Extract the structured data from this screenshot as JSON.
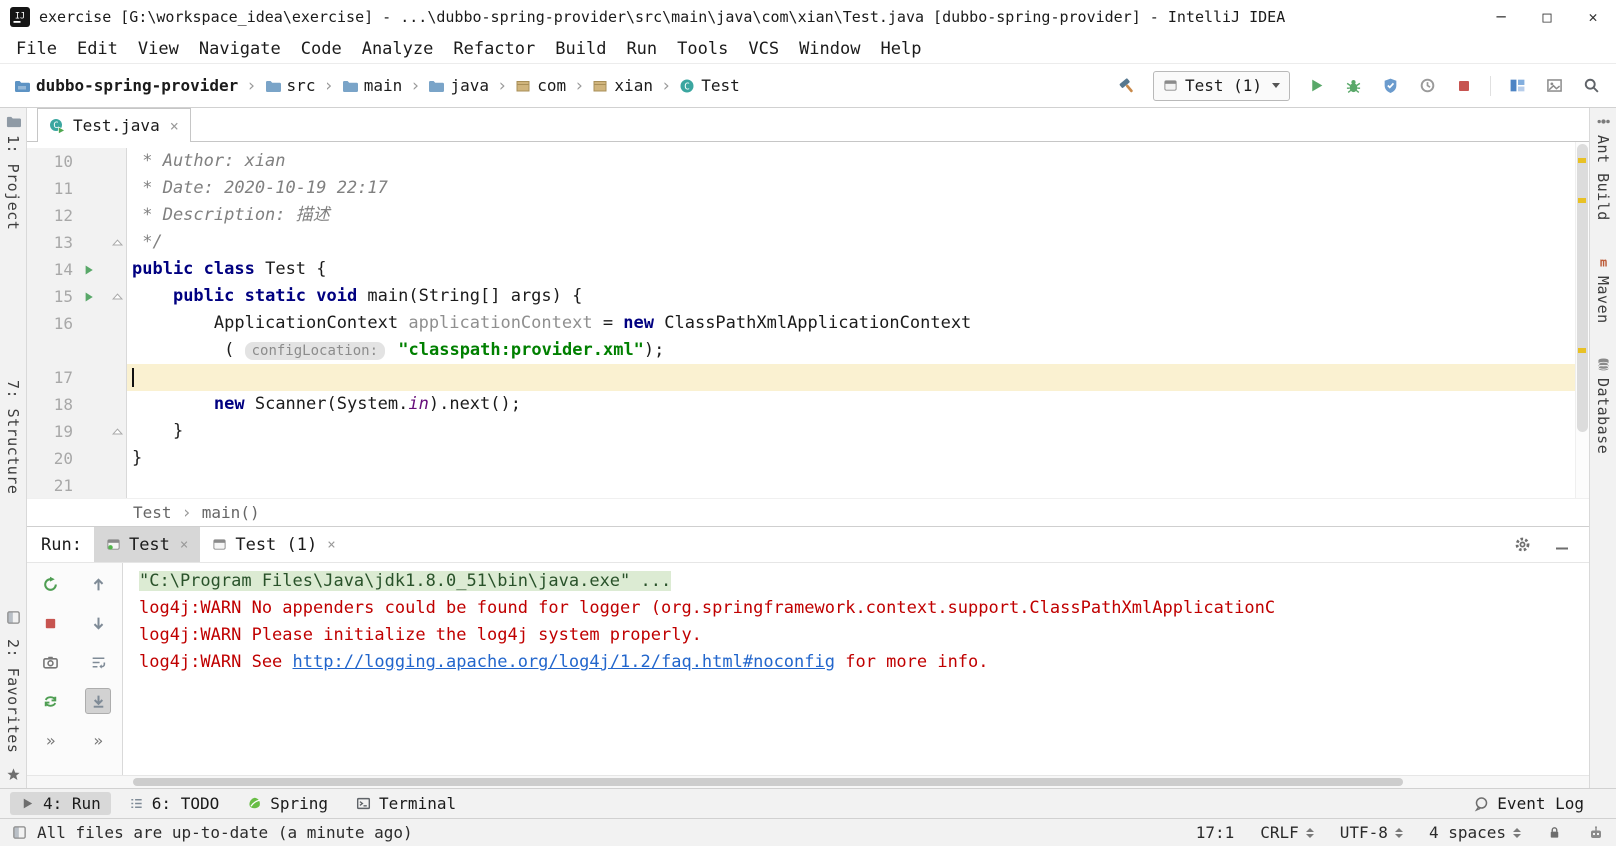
{
  "title_bar": {
    "title": "exercise [G:\\workspace_idea\\exercise] - ...\\dubbo-spring-provider\\src\\main\\java\\com\\xian\\Test.java [dubbo-spring-provider] - IntelliJ IDEA"
  },
  "menu_bar": {
    "items": [
      "File",
      "Edit",
      "View",
      "Navigate",
      "Code",
      "Analyze",
      "Refactor",
      "Build",
      "Run",
      "Tools",
      "VCS",
      "Window",
      "Help"
    ]
  },
  "nav_bar": {
    "breadcrumbs": [
      {
        "label": "dubbo-spring-provider",
        "icon": "project-folder-icon"
      },
      {
        "label": "src",
        "icon": "folder-icon"
      },
      {
        "label": "main",
        "icon": "folder-icon"
      },
      {
        "label": "java",
        "icon": "folder-icon"
      },
      {
        "label": "com",
        "icon": "package-icon"
      },
      {
        "label": "xian",
        "icon": "package-icon"
      },
      {
        "label": "Test",
        "icon": "class-icon"
      }
    ],
    "run_config": {
      "label": "Test (1)"
    },
    "icons_before": [
      "build-hammer-icon"
    ],
    "icons_run": [
      "run-button-icon",
      "debug-button-icon",
      "coverage-button-icon",
      "profiler-button-icon",
      "stop-button-icon"
    ],
    "icons_tools": [
      "panels-icon",
      "image-icon"
    ],
    "icons_search": [
      "search-everywhere-icon"
    ]
  },
  "editor": {
    "tab": {
      "label": "Test.java",
      "close": "×"
    },
    "breadcrumb": [
      "Test",
      "main()"
    ],
    "lines": [
      {
        "num": "10",
        "segs": [
          {
            "t": " * Author: xian",
            "c": "cmt"
          }
        ]
      },
      {
        "num": "11",
        "segs": [
          {
            "t": " * Date: 2020-10-19 22:17",
            "c": "cmt"
          }
        ]
      },
      {
        "num": "12",
        "segs": [
          {
            "t": " * Description: 描述",
            "c": "cmt"
          }
        ]
      },
      {
        "num": "13",
        "fold": true,
        "segs": [
          {
            "t": " */",
            "c": "cmt"
          }
        ]
      },
      {
        "num": "14",
        "run": true,
        "segs": [
          {
            "t": "public",
            "c": "kw"
          },
          {
            "t": " ",
            "c": ""
          },
          {
            "t": "class",
            "c": "kw"
          },
          {
            "t": " Test {",
            "c": ""
          }
        ]
      },
      {
        "num": "15",
        "run": true,
        "fold": true,
        "segs": [
          {
            "t": "    ",
            "c": ""
          },
          {
            "t": "public static void",
            "c": "kw"
          },
          {
            "t": " main(String[] args) {",
            "c": ""
          }
        ]
      },
      {
        "num": "16",
        "segs": [
          {
            "t": "        ApplicationContext ",
            "c": ""
          },
          {
            "t": "applicationContext",
            "c": "dim"
          },
          {
            "t": " = ",
            "c": ""
          },
          {
            "t": "new",
            "c": "kw"
          },
          {
            "t": " ClassPathXmlApplicationContext",
            "c": ""
          }
        ]
      },
      {
        "num": "",
        "segs": [
          {
            "t": "         ( ",
            "c": ""
          },
          {
            "t": "configLocation:",
            "c": "hint"
          },
          {
            "t": " ",
            "c": ""
          },
          {
            "t": "\"classpath:provider.xml\"",
            "c": "str"
          },
          {
            "t": ");",
            "c": ""
          }
        ]
      },
      {
        "num": "17",
        "current": true,
        "caret": true,
        "segs": []
      },
      {
        "num": "18",
        "segs": [
          {
            "t": "        ",
            "c": ""
          },
          {
            "t": "new",
            "c": "kw"
          },
          {
            "t": " Scanner(System.",
            "c": ""
          },
          {
            "t": "in",
            "c": "fld"
          },
          {
            "t": ").next();",
            "c": ""
          }
        ]
      },
      {
        "num": "19",
        "fold": true,
        "segs": [
          {
            "t": "    }",
            "c": ""
          }
        ]
      },
      {
        "num": "20",
        "segs": [
          {
            "t": "}",
            "c": ""
          }
        ]
      },
      {
        "num": "21",
        "segs": []
      }
    ]
  },
  "run_panel": {
    "label": "Run:",
    "tabs": [
      {
        "label": "Test",
        "active": true,
        "running": true,
        "close": "×"
      },
      {
        "label": "Test (1)",
        "active": false,
        "running": false,
        "close": "×"
      }
    ],
    "header_icons": [
      "gear-icon",
      "hide-icon"
    ],
    "toolbar_left": [
      "rerun-icon",
      "stop-square-icon",
      "thread-dump-camera-icon",
      "update-application-icon",
      "more-actions-icon"
    ],
    "toolbar_console": [
      "up-stack-icon",
      "down-stack-icon",
      "soft-wrap-icon",
      "scroll-to-end-icon",
      "more-actions-icon"
    ],
    "console": [
      {
        "type": "command",
        "text": "\"C:\\Program Files\\Java\\jdk1.8.0_51\\bin\\java.exe\" ..."
      },
      {
        "type": "error",
        "text": "log4j:WARN No appenders could be found for logger (org.springframework.context.support.ClassPathXmlApplicationC"
      },
      {
        "type": "error",
        "text": "log4j:WARN Please initialize the log4j system properly."
      },
      {
        "type": "error",
        "text_before": "log4j:WARN See ",
        "link": "http://logging.apache.org/log4j/1.2/faq.html#noconfig",
        "text_after": " for more info."
      }
    ]
  },
  "tool_stripes": {
    "left_top": [
      {
        "name": "tool-stripe-project",
        "icon": "project-stripe-icon",
        "label": "1: Project"
      }
    ],
    "left_middle": [
      {
        "name": "tool-stripe-structure",
        "label": "7: Structure"
      }
    ],
    "left_bottom": [
      {
        "name": "tool-window-switcher-icon",
        "icon": "switcher-grid-icon"
      },
      {
        "name": "tool-stripe-favorites",
        "label": "2: Favorites"
      },
      {
        "name": "favorites-star-icon",
        "icon": "star-icon"
      }
    ],
    "right": [
      {
        "name": "tool-stripe-ant-build",
        "icon": "ant-icon",
        "label": "Ant Build"
      },
      {
        "name": "tool-stripe-maven",
        "icon": "maven-icon",
        "label": "Maven"
      },
      {
        "name": "tool-stripe-database",
        "icon": "database-icon",
        "label": "Database"
      }
    ]
  },
  "bottom_bar": {
    "left": [
      {
        "name": "tool-window-run",
        "icon": "run-tool-icon",
        "label": "4: Run",
        "active": true
      },
      {
        "name": "tool-window-todo",
        "icon": "todo-icon",
        "label": "6: TODO",
        "active": false
      },
      {
        "name": "tool-window-spring",
        "icon": "spring-icon",
        "label": "Spring",
        "active": false
      },
      {
        "name": "tool-window-terminal",
        "icon": "terminal-icon",
        "label": "Terminal",
        "active": false
      }
    ],
    "right": [
      {
        "name": "event-log-button",
        "icon": "event-log-icon",
        "label": "Event Log"
      }
    ]
  },
  "status_bar": {
    "message": "All files are up-to-date (a minute ago)",
    "caret_position": "17:1",
    "line_ending": "CRLF",
    "encoding": "UTF-8",
    "indent": "4 spaces"
  },
  "colors": {
    "accent_green": "#59A869",
    "stop_red": "#C75450",
    "error_red": "#C00000",
    "link_blue": "#2266CC",
    "keyword_blue": "#000080",
    "string_green": "#008000",
    "comment_gray": "#808080",
    "field_purple": "#660E7A",
    "current_line": "#FAF1D1",
    "warning_stripe": "#E8C125"
  }
}
